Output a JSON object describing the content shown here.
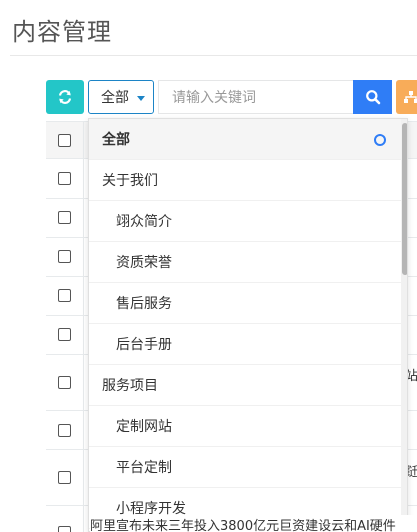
{
  "page": {
    "title": "内容管理"
  },
  "toolbar": {
    "refresh_icon": "refresh-icon",
    "category_selected": "全部",
    "search_placeholder": "请输入关键词",
    "search_icon": "search-icon",
    "extra_icon": "sitemap-icon",
    "colors": {
      "refresh": "#23c6c8",
      "search": "#2f7df6",
      "extra": "#f8ac59",
      "select_border": "#1c84c6"
    }
  },
  "table": {
    "peek_texts": [
      "站",
      "跹"
    ],
    "bottom_row_text": "阿里宣布未来三年投入3800亿元巨资建设云和AI硬件"
  },
  "dropdown": {
    "items": [
      {
        "label": "全部",
        "level": 0,
        "selected": true
      },
      {
        "label": "关于我们",
        "level": 0,
        "selected": false
      },
      {
        "label": "翊众简介",
        "level": 1,
        "selected": false
      },
      {
        "label": "资质荣誉",
        "level": 1,
        "selected": false
      },
      {
        "label": "售后服务",
        "level": 1,
        "selected": false
      },
      {
        "label": "后台手册",
        "level": 1,
        "selected": false
      },
      {
        "label": "服务项目",
        "level": 0,
        "selected": false
      },
      {
        "label": "定制网站",
        "level": 1,
        "selected": false
      },
      {
        "label": "平台定制",
        "level": 1,
        "selected": false
      },
      {
        "label": "小程序开发",
        "level": 1,
        "selected": false
      }
    ]
  }
}
